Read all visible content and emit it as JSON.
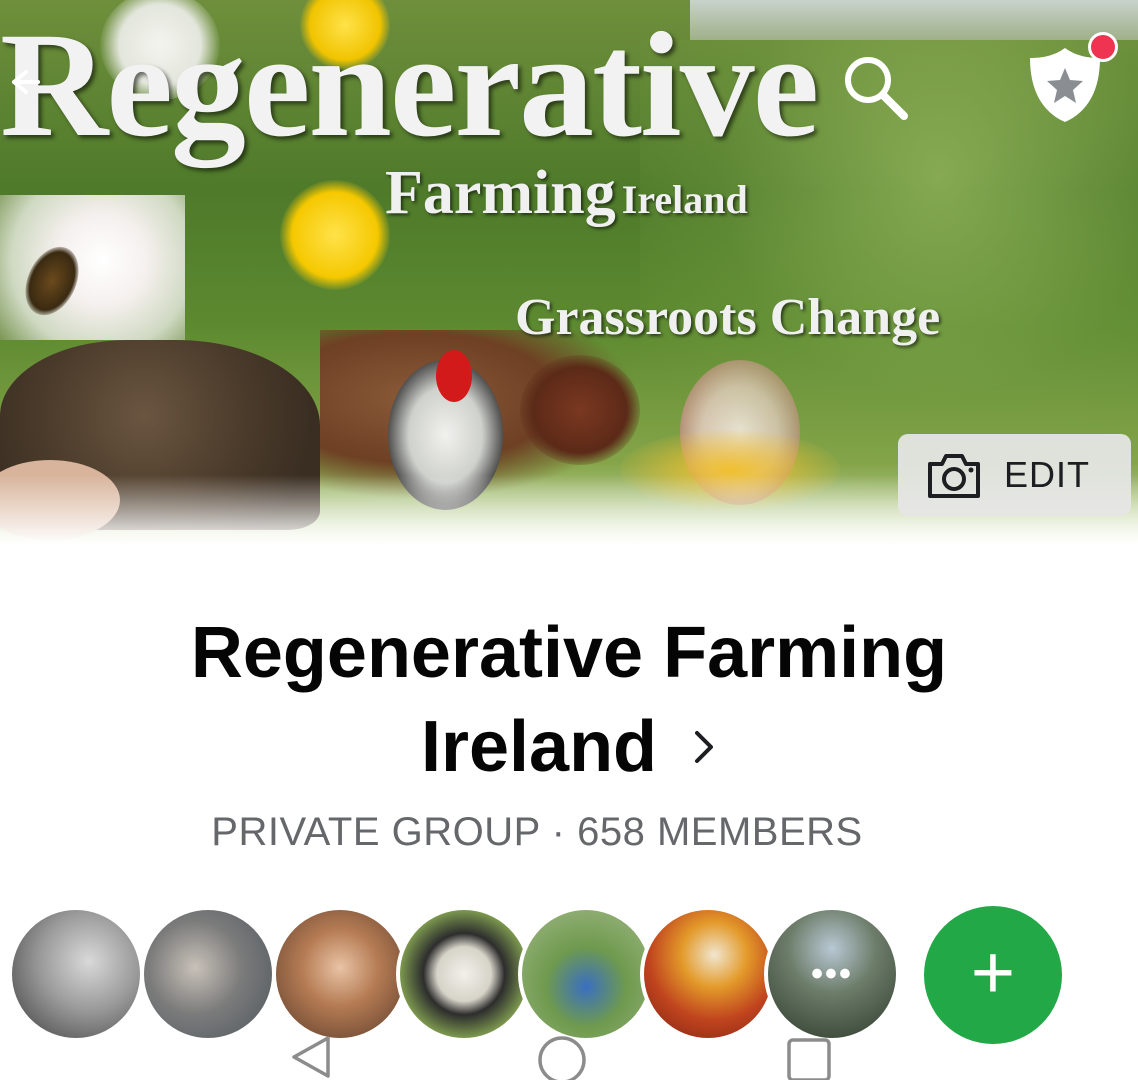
{
  "cover": {
    "title": "Regenerative",
    "subtitle": "Farming",
    "subtitle_small": "Ireland",
    "tagline": "Grassroots Change",
    "edit_label": "EDIT"
  },
  "group": {
    "name_line1": "Regenerative Farming",
    "name_line2": "Ireland",
    "meta": "PRIVATE GROUP · 658 MEMBERS"
  },
  "members": {
    "avatars": [
      {
        "name": "member-1",
        "bg": "#8a8a8a"
      },
      {
        "name": "member-2",
        "bg": "#5e6a70"
      },
      {
        "name": "member-3",
        "bg": "#b25a35"
      },
      {
        "name": "member-4",
        "bg": "#7ea14a"
      },
      {
        "name": "member-5",
        "bg": "#6f9a4e"
      },
      {
        "name": "member-6",
        "bg": "#c0441e"
      },
      {
        "name": "member-7",
        "bg": "#3f4f3a"
      }
    ],
    "more_label": "•••",
    "add_label": "+"
  },
  "colors": {
    "accent_green": "#23a848",
    "notification_red": "#ee3450",
    "meta_grey": "#65676b"
  },
  "icons": [
    "back-arrow-icon",
    "search-icon",
    "shield-star-icon",
    "camera-icon",
    "chevron-right-icon",
    "plus-icon",
    "nav-back-icon",
    "nav-home-icon",
    "nav-recents-icon"
  ]
}
